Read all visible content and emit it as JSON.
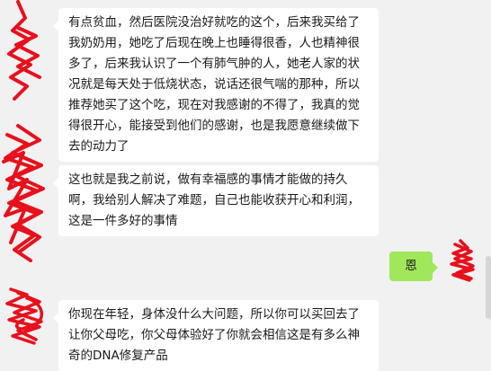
{
  "messages": [
    {
      "side": "left",
      "text": "有点贫血，然后医院没治好就吃的这个，后来我买给了我奶奶用，她吃了后现在晚上也睡得很香，人也精神很多了，后来我认识了一个有肺气肿的人，她老人家的状况就是每天处于低烧状态，说话还很气喘的那种，所以推荐她买了这个吃，现在对我感谢的不得了，我真的觉得很开心，能接受到他们的感谢，也是我愿意继续做下去的动力了"
    },
    {
      "side": "left",
      "text": "这也就是我之前说，做有幸福感的事情才能做的持久啊，我给别人解决了难题，自己也能收获开心和利润，这是一件多好的事情"
    },
    {
      "side": "right",
      "text": "恩"
    },
    {
      "side": "left",
      "text": "你现在年轻，身体没什么大问题，所以你可以买回去了让你父母吃，你父母体验好了你就会相信这是有多么神奇的DNA修复产品"
    }
  ],
  "colors": {
    "background": "#f1f1f1",
    "received_bubble": "#ffffff",
    "sent_bubble": "#a0e75a",
    "redaction_scribble": "#e8101c"
  }
}
